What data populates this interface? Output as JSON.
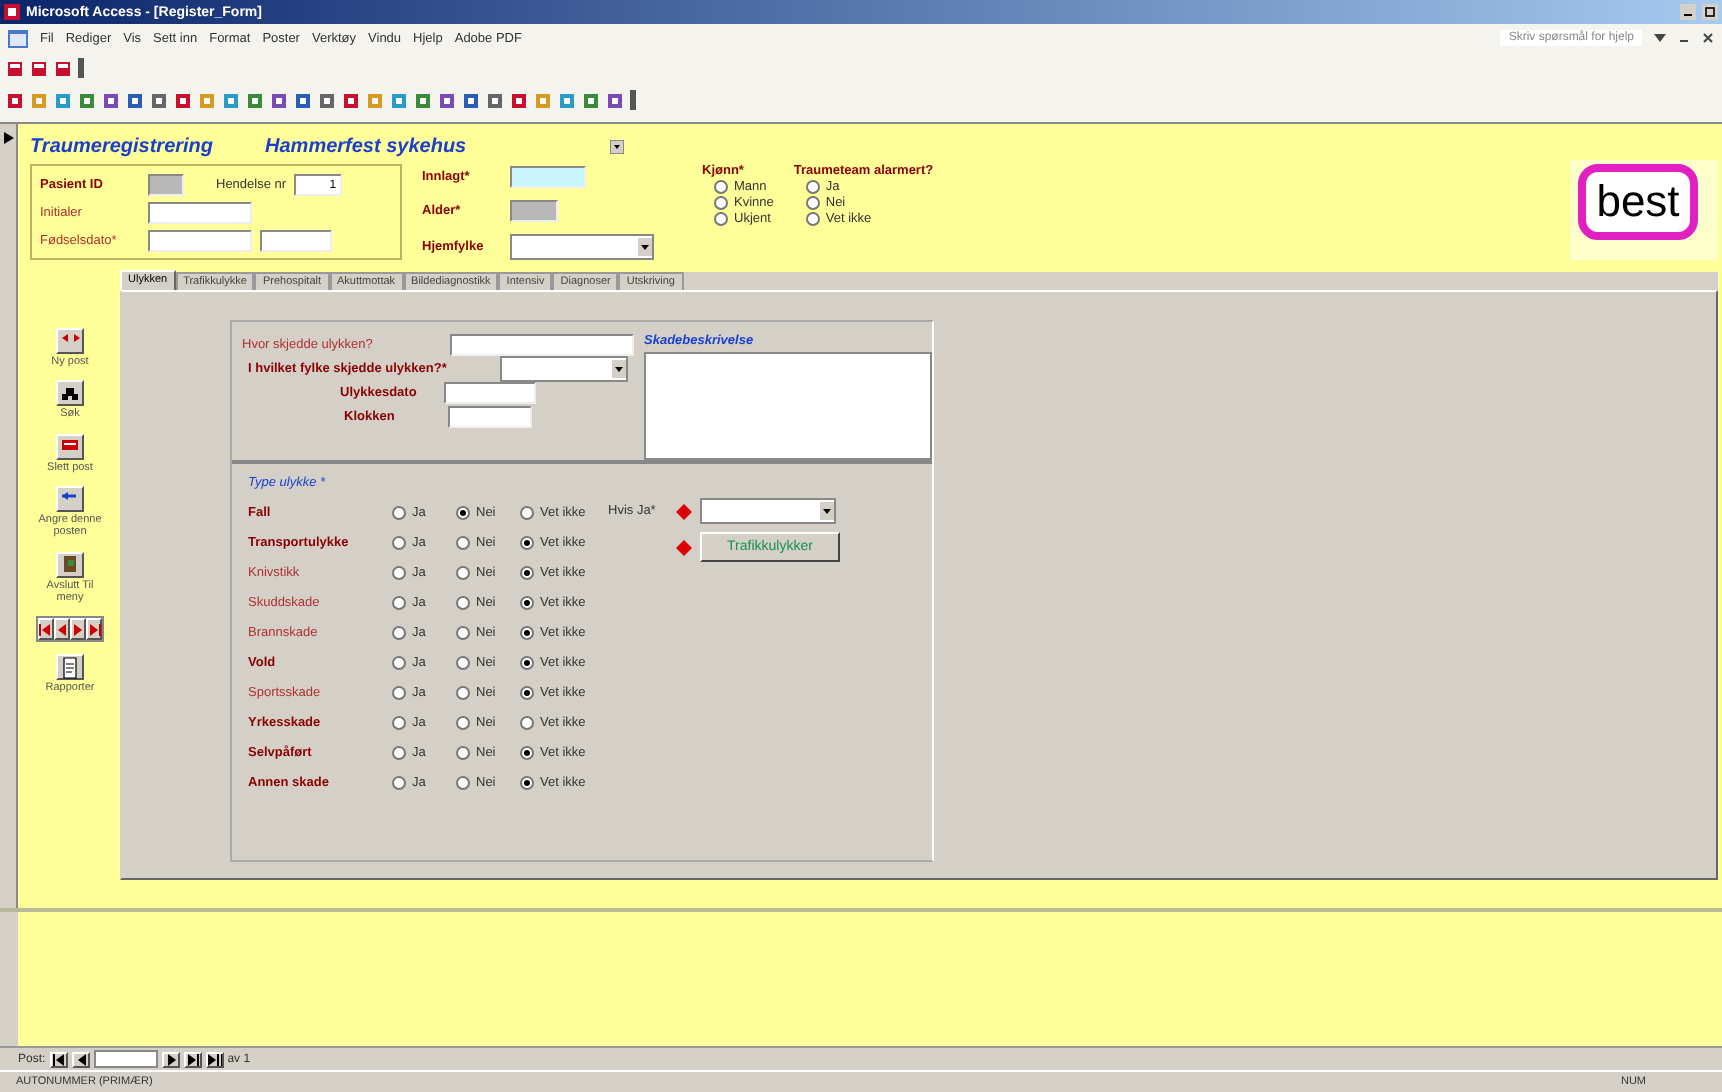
{
  "window": {
    "title": "Microsoft Access - [Register_Form]"
  },
  "menu": [
    "Fil",
    "Rediger",
    "Vis",
    "Sett inn",
    "Format",
    "Poster",
    "Verktøy",
    "Vindu",
    "Hjelp",
    "Adobe PDF"
  ],
  "help_box": "Skriv spørsmål for hjelp",
  "form": {
    "title": "Traumeregistrering",
    "hospital": "Hammerfest sykehus",
    "logo": "best",
    "patient": {
      "id_label": "Pasient ID",
      "incident_label": "Hendelse nr",
      "incident_value": "1",
      "initials_label": "Initialer",
      "birth_label": "Fødselsdato*"
    },
    "admission": {
      "admitted_label": "Innlagt*",
      "age_label": "Alder*",
      "county_label": "Hjemfylke"
    },
    "sex": {
      "label": "Kjønn*",
      "options": [
        {
          "label": "Mann",
          "selected": false
        },
        {
          "label": "Kvinne",
          "selected": false
        },
        {
          "label": "Ukjent",
          "selected": false
        }
      ]
    },
    "team": {
      "label": "Traumeteam alarmert?",
      "options": [
        {
          "label": "Ja",
          "selected": false
        },
        {
          "label": "Nei",
          "selected": false
        },
        {
          "label": "Vet ikke",
          "selected": false
        }
      ]
    },
    "tabs": [
      {
        "label": "Ulykken",
        "selected": true
      },
      {
        "label": "Trafikkulykke",
        "selected": false
      },
      {
        "label": "Prehospitalt",
        "selected": false
      },
      {
        "label": "Akuttmottak",
        "selected": false
      },
      {
        "label": "Bildediagnostikk",
        "selected": false
      },
      {
        "label": "Intensiv",
        "selected": false
      },
      {
        "label": "Diagnoser",
        "selected": false
      },
      {
        "label": "Utskriving",
        "selected": false
      }
    ],
    "side_buttons": [
      {
        "kind": "new",
        "label": "Ny post"
      },
      {
        "kind": "search",
        "label": "Søk"
      },
      {
        "kind": "delete",
        "label": "Slett post"
      },
      {
        "kind": "undo",
        "label": "Angre denne posten"
      },
      {
        "kind": "exit",
        "label": "Avslutt Til meny"
      },
      {
        "kind": "nav"
      },
      {
        "kind": "report",
        "label": "Rapporter"
      }
    ],
    "accident": {
      "where_label": "Hvor skjedde ulykken?",
      "county_label": "I hvilket fylke skjedde ulykken?*",
      "date_label": "Ulykkesdato",
      "time_label": "Klokken",
      "description_label": "Skadebeskrivelse",
      "type_label": "Type ulykke *",
      "if_yes_label": "Hvis Ja*",
      "traffic_button": "Trafikkulykker",
      "types": [
        {
          "label": "Fall",
          "required": true,
          "options": [
            {
              "label": "Ja",
              "selected": false
            },
            {
              "label": "Nei",
              "selected": true
            },
            {
              "label": "Vet ikke",
              "selected": false
            }
          ]
        },
        {
          "label": "Transportulykke",
          "required": true,
          "options": [
            {
              "label": "Ja",
              "selected": false
            },
            {
              "label": "Nei",
              "selected": false
            },
            {
              "label": "Vet ikke",
              "selected": true
            }
          ]
        },
        {
          "label": "Knivstikk",
          "required": false,
          "options": [
            {
              "label": "Ja",
              "selected": false
            },
            {
              "label": "Nei",
              "selected": false
            },
            {
              "label": "Vet ikke",
              "selected": true
            }
          ]
        },
        {
          "label": "Skuddskade",
          "required": false,
          "options": [
            {
              "label": "Ja",
              "selected": false
            },
            {
              "label": "Nei",
              "selected": false
            },
            {
              "label": "Vet ikke",
              "selected": true
            }
          ]
        },
        {
          "label": "Brannskade",
          "required": false,
          "options": [
            {
              "label": "Ja",
              "selected": false
            },
            {
              "label": "Nei",
              "selected": false
            },
            {
              "label": "Vet ikke",
              "selected": true
            }
          ]
        },
        {
          "label": "Vold",
          "required": true,
          "options": [
            {
              "label": "Ja",
              "selected": false
            },
            {
              "label": "Nei",
              "selected": false
            },
            {
              "label": "Vet ikke",
              "selected": true
            }
          ]
        },
        {
          "label": "Sportsskade",
          "required": false,
          "options": [
            {
              "label": "Ja",
              "selected": false
            },
            {
              "label": "Nei",
              "selected": false
            },
            {
              "label": "Vet ikke",
              "selected": true
            }
          ]
        },
        {
          "label": "Yrkesskade",
          "required": true,
          "options": [
            {
              "label": "Ja",
              "selected": false
            },
            {
              "label": "Nei",
              "selected": false
            },
            {
              "label": "Vet ikke",
              "selected": false
            }
          ]
        },
        {
          "label": "Selvpåført",
          "required": true,
          "options": [
            {
              "label": "Ja",
              "selected": false
            },
            {
              "label": "Nei",
              "selected": false
            },
            {
              "label": "Vet ikke",
              "selected": true
            }
          ]
        },
        {
          "label": "Annen skade",
          "required": true,
          "options": [
            {
              "label": "Ja",
              "selected": false
            },
            {
              "label": "Nei",
              "selected": false
            },
            {
              "label": "Vet ikke",
              "selected": true
            }
          ]
        }
      ]
    }
  },
  "record_nav": {
    "label": "Post:",
    "count": "av 1"
  },
  "status_bar": {
    "left": "AUTONUMMER (PRIMÆR)",
    "right": "NUM"
  }
}
